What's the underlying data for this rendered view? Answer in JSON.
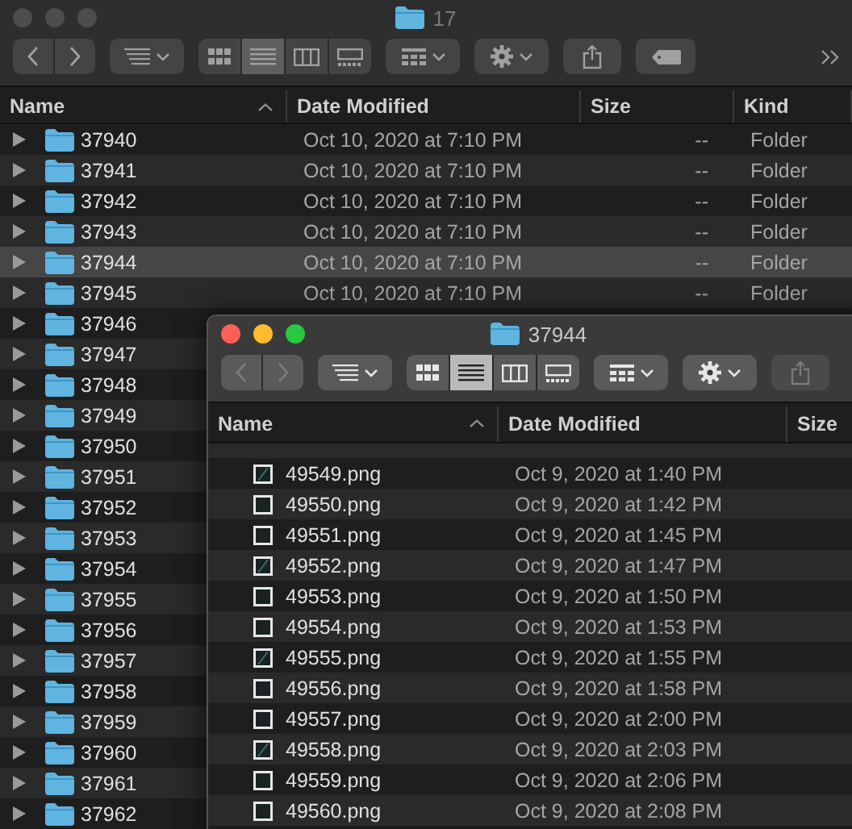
{
  "back_window": {
    "title": "17",
    "active": false,
    "toolbar": [
      {
        "kind": "navigation"
      },
      {
        "kind": "arrange"
      },
      {
        "kind": "views",
        "modes": [
          {
            "kind": "icons",
            "selected": false
          },
          {
            "kind": "list",
            "selected": true
          },
          {
            "kind": "columns",
            "selected": false
          },
          {
            "kind": "gallery",
            "selected": false
          }
        ]
      },
      {
        "kind": "group"
      },
      {
        "kind": "action"
      },
      {
        "kind": "share",
        "disabled": false
      },
      {
        "kind": "tag"
      },
      {
        "kind": "overflow"
      }
    ],
    "columns": [
      {
        "label": "Name",
        "sorted": true
      },
      {
        "label": "Date Modified",
        "sorted": false
      },
      {
        "label": "Size",
        "sorted": false
      },
      {
        "label": "Kind",
        "sorted": false
      }
    ],
    "rows": [
      {
        "name": "37940",
        "date": "Oct 10, 2020 at 7:10 PM",
        "size": "--",
        "kind": "Folder",
        "selected": false
      },
      {
        "name": "37941",
        "date": "Oct 10, 2020 at 7:10 PM",
        "size": "--",
        "kind": "Folder",
        "selected": false
      },
      {
        "name": "37942",
        "date": "Oct 10, 2020 at 7:10 PM",
        "size": "--",
        "kind": "Folder",
        "selected": false
      },
      {
        "name": "37943",
        "date": "Oct 10, 2020 at 7:10 PM",
        "size": "--",
        "kind": "Folder",
        "selected": false
      },
      {
        "name": "37944",
        "date": "Oct 10, 2020 at 7:10 PM",
        "size": "--",
        "kind": "Folder",
        "selected": true
      },
      {
        "name": "37945",
        "date": "Oct 10, 2020 at 7:10 PM",
        "size": "--",
        "kind": "Folder",
        "selected": false
      },
      {
        "name": "37946",
        "selected": false
      },
      {
        "name": "37947",
        "selected": false
      },
      {
        "name": "37948",
        "selected": false
      },
      {
        "name": "37949",
        "selected": false
      },
      {
        "name": "37950",
        "selected": false
      },
      {
        "name": "37951",
        "selected": false
      },
      {
        "name": "37952",
        "selected": false
      },
      {
        "name": "37953",
        "selected": false
      },
      {
        "name": "37954",
        "selected": false
      },
      {
        "name": "37955",
        "selected": false
      },
      {
        "name": "37956",
        "selected": false
      },
      {
        "name": "37957",
        "selected": false
      },
      {
        "name": "37958",
        "selected": false
      },
      {
        "name": "37959",
        "selected": false
      },
      {
        "name": "37960",
        "selected": false
      },
      {
        "name": "37961",
        "selected": false
      },
      {
        "name": "37962",
        "selected": false
      }
    ]
  },
  "front_window": {
    "title": "37944",
    "active": true,
    "toolbar": [
      {
        "kind": "navigation"
      },
      {
        "kind": "arrange"
      },
      {
        "kind": "views",
        "modes": [
          {
            "kind": "icons",
            "selected": false
          },
          {
            "kind": "list",
            "selected": true
          },
          {
            "kind": "columns",
            "selected": false
          },
          {
            "kind": "gallery",
            "selected": false
          }
        ]
      },
      {
        "kind": "group"
      },
      {
        "kind": "action"
      },
      {
        "kind": "share",
        "disabled": true
      }
    ],
    "columns": [
      {
        "label": "Name",
        "sorted": true
      },
      {
        "label": "Date Modified",
        "sorted": false
      },
      {
        "label": "Size",
        "sorted": false
      }
    ],
    "rows": [
      {
        "name": "49549.png",
        "date": "Oct 9, 2020 at 1:40 PM",
        "selected": false
      },
      {
        "name": "49550.png",
        "date": "Oct 9, 2020 at 1:42 PM",
        "selected": false
      },
      {
        "name": "49551.png",
        "date": "Oct 9, 2020 at 1:45 PM",
        "selected": false
      },
      {
        "name": "49552.png",
        "date": "Oct 9, 2020 at 1:47 PM",
        "selected": false
      },
      {
        "name": "49553.png",
        "date": "Oct 9, 2020 at 1:50 PM",
        "selected": false
      },
      {
        "name": "49554.png",
        "date": "Oct 9, 2020 at 1:53 PM",
        "selected": false
      },
      {
        "name": "49555.png",
        "date": "Oct 9, 2020 at 1:55 PM",
        "selected": false
      },
      {
        "name": "49556.png",
        "date": "Oct 9, 2020 at 1:58 PM",
        "selected": false
      },
      {
        "name": "49557.png",
        "date": "Oct 9, 2020 at 2:00 PM",
        "selected": false
      },
      {
        "name": "49558.png",
        "date": "Oct 9, 2020 at 2:03 PM",
        "selected": false
      },
      {
        "name": "49559.png",
        "date": "Oct 9, 2020 at 2:06 PM",
        "selected": false
      },
      {
        "name": "49560.png",
        "date": "Oct 9, 2020 at 2:08 PM",
        "selected": false
      }
    ]
  }
}
